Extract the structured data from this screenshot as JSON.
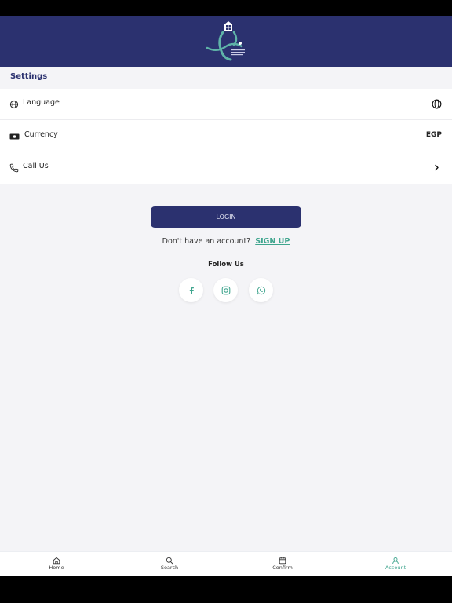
{
  "settings": {
    "title": "Settings",
    "rows": [
      {
        "label": "Language",
        "icon": "globe-icon"
      },
      {
        "label": "Currency",
        "icon": "money-icon",
        "value": "EGP"
      },
      {
        "label": "Call Us",
        "icon": "phone-icon"
      }
    ]
  },
  "auth": {
    "login_label": "LOGIN",
    "no_account_text": "Don't have an account?",
    "signup_label": "SIGN UP"
  },
  "social": {
    "title": "Follow Us",
    "icons": [
      "facebook-icon",
      "instagram-icon",
      "whatsapp-icon"
    ]
  },
  "tabs": [
    {
      "label": "Home",
      "icon": "home-icon"
    },
    {
      "label": "Search",
      "icon": "search-icon"
    },
    {
      "label": "Confirm",
      "icon": "calendar-icon"
    },
    {
      "label": "Account",
      "icon": "user-icon",
      "active": true
    }
  ],
  "colors": {
    "brand": "#2b316f",
    "accent": "#3fa58e",
    "background": "#f4f4f7"
  }
}
